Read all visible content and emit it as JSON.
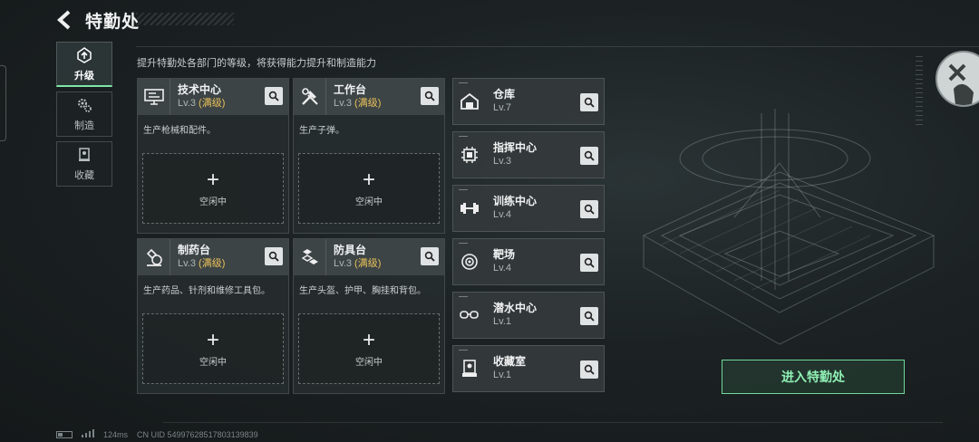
{
  "header": {
    "title": "特勤处"
  },
  "nav": [
    {
      "label": "升级",
      "icon": "upgrade-icon",
      "active": true
    },
    {
      "label": "制造",
      "icon": "gear-icon",
      "active": false
    },
    {
      "label": "收藏",
      "icon": "collection-icon",
      "active": false
    }
  ],
  "description": "提升特勤处各部门的等级，将获得能力提升和制造能力",
  "facilities": [
    {
      "name": "技术中心",
      "level": "Lv.3",
      "maxed": "(满级)",
      "desc": "生产枪械和配件。",
      "slot": "空闲中",
      "icon": "tech-center-icon"
    },
    {
      "name": "工作台",
      "level": "Lv.3",
      "maxed": "(满级)",
      "desc": "生产子弹。",
      "slot": "空闲中",
      "icon": "workbench-icon"
    },
    {
      "name": "制药台",
      "level": "Lv.3",
      "maxed": "(满级)",
      "desc": "生产药品、针剂和维修工具包。",
      "slot": "空闲中",
      "icon": "pharmacy-icon"
    },
    {
      "name": "防具台",
      "level": "Lv.3",
      "maxed": "(满级)",
      "desc": "生产头盔、护甲、胸挂和背包。",
      "slot": "空闲中",
      "icon": "armor-bench-icon"
    }
  ],
  "departments": [
    {
      "name": "仓库",
      "level": "Lv.7",
      "icon": "warehouse-icon"
    },
    {
      "name": "指挥中心",
      "level": "Lv.3",
      "icon": "command-center-icon"
    },
    {
      "name": "训练中心",
      "level": "Lv.4",
      "icon": "dumbbell-icon"
    },
    {
      "name": "靶场",
      "level": "Lv.4",
      "icon": "target-icon"
    },
    {
      "name": "潜水中心",
      "level": "Lv.1",
      "icon": "diving-mask-icon"
    },
    {
      "name": "收藏室",
      "level": "Lv.1",
      "icon": "trophy-icon"
    }
  ],
  "enter_button": "进入特勤处",
  "status": {
    "ping": "124ms",
    "uid": "CN UID 549976285178031398​39"
  },
  "colors": {
    "accent": "#7fe6a6",
    "maxed": "#e8c05a",
    "panel": "#3e4648"
  }
}
